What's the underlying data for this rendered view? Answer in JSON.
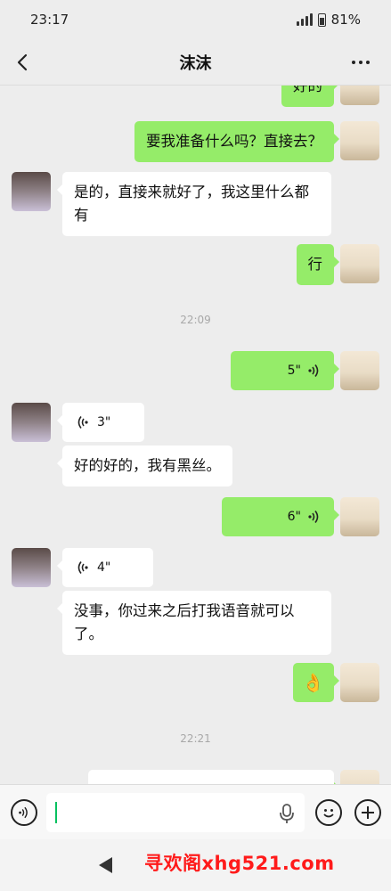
{
  "status": {
    "time": "23:17",
    "battery": "81%"
  },
  "header": {
    "title": "沫沫"
  },
  "messages": {
    "m1": "好的",
    "m2": "要我准备什么吗？直接去？",
    "m3": "是的，直接来就好了，我这里什么都有",
    "m4": "行",
    "t1": "22:09",
    "v1": "5\"",
    "v2": "3\"",
    "m5": "好的好的，我有黑丝。",
    "v3": "6\"",
    "v4": "4\"",
    "m6": "没事，你过来之后打我语音就可以了。",
    "m7": "👌",
    "t2": "22:21"
  },
  "input": {
    "value": ""
  },
  "watermark": "寻欢阁xhg521.com",
  "colors": {
    "my_bubble": "#95ec69",
    "their_bubble": "#ffffff",
    "background": "#ededed",
    "watermark": "#ff1a1a"
  }
}
